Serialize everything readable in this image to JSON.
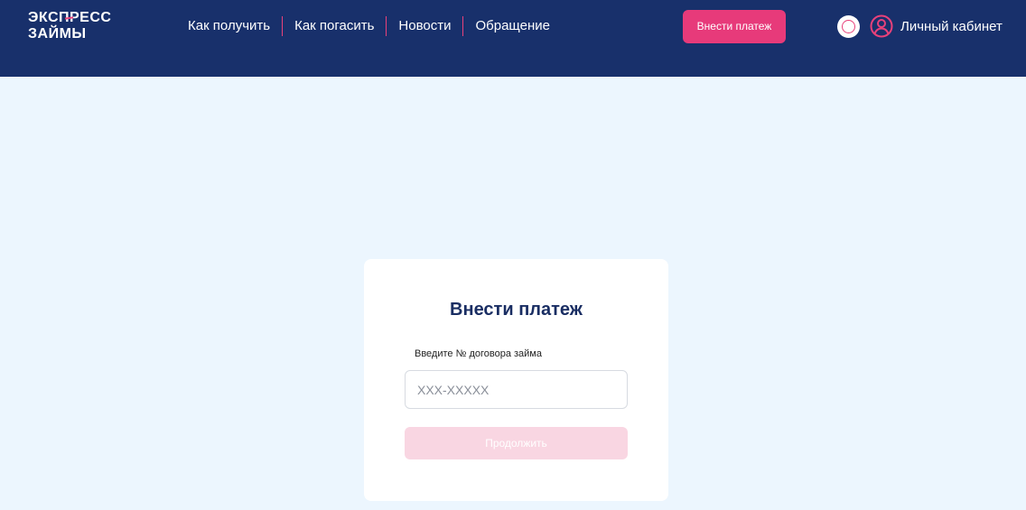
{
  "header": {
    "logo_line1": "ЭКСПРЕСС",
    "logo_line2": "ЗАЙМЫ",
    "nav": [
      {
        "label": "Как получить"
      },
      {
        "label": "Как погасить"
      },
      {
        "label": "Новости"
      },
      {
        "label": "Обращение"
      }
    ],
    "pay_button_label": "Внести платеж",
    "account_label": "Личный кабинет",
    "badge_icon": "certificate-badge-icon"
  },
  "payment_form": {
    "title": "Внести платеж",
    "contract_label": "Введите № договора займа",
    "contract_placeholder": "XXX-XXXXX",
    "contract_value": "",
    "continue_label": "Продолжить"
  },
  "colors": {
    "header_bg": "#18306b",
    "accent": "#e73a7a",
    "page_bg": "#ecf6fe",
    "title": "#1a2e63",
    "button_disabled": "#f9d6e2"
  }
}
